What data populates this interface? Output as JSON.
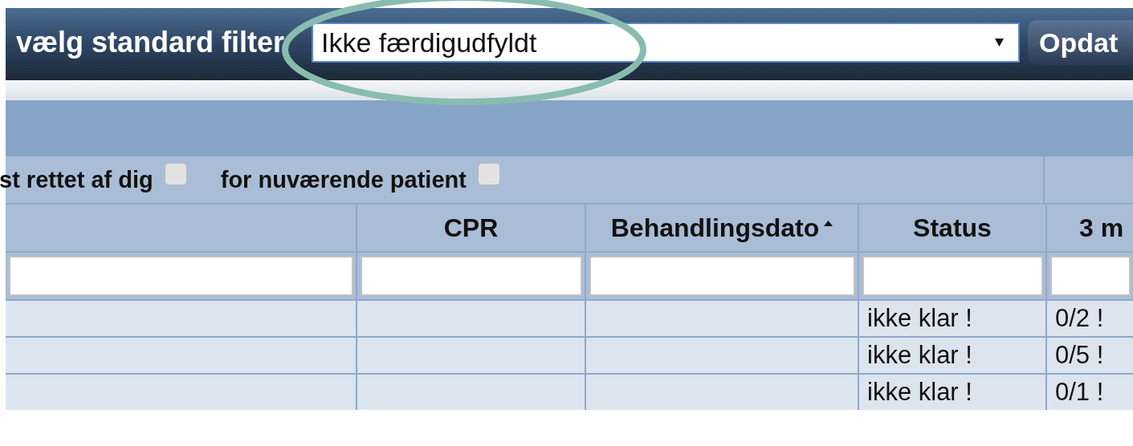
{
  "toolbar": {
    "filter_label": "vælg standard filter",
    "filter_select": {
      "value": "Ikke færdigudfyldt"
    },
    "update_button": "Opdat"
  },
  "annotation": {
    "kind": "ellipse",
    "color": "#88bcae"
  },
  "options": [
    {
      "label": "st rettet af dig",
      "checked": false
    },
    {
      "label": "for nuværende patient",
      "checked": false
    }
  ],
  "table": {
    "columns": [
      {
        "sorted": false
      },
      {
        "label": "CPR",
        "sorted": false
      },
      {
        "label": "Behandlingsdato",
        "sorted": true
      },
      {
        "label": "Status",
        "sorted": false
      },
      {
        "label": "3 m",
        "sorted": false
      }
    ],
    "rows": [
      [
        "",
        "",
        "",
        "ikke klar !",
        "0/2 !"
      ],
      [
        "",
        "",
        "",
        "ikke klar !",
        "0/5 !"
      ],
      [
        "",
        "",
        "",
        "ikke klar !",
        "0/1 !"
      ]
    ]
  }
}
